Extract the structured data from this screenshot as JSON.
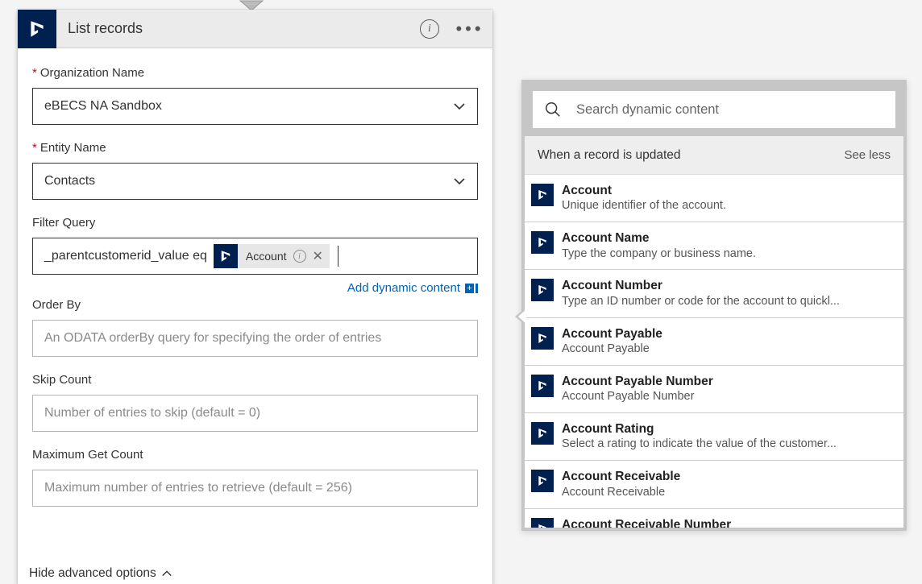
{
  "top_icon": "arrow-down",
  "card": {
    "title": "List records",
    "fields": {
      "org": {
        "label": "Organization Name",
        "value": "eBECS NA Sandbox",
        "required": true
      },
      "entity": {
        "label": "Entity Name",
        "value": "Contacts",
        "required": true
      },
      "filter": {
        "label": "Filter Query",
        "text": "_parentcustomerid_value eq",
        "token_label": "Account",
        "add_link": "Add dynamic content"
      },
      "orderby": {
        "label": "Order By",
        "placeholder": "An ODATA orderBy query for specifying the order of entries"
      },
      "skip": {
        "label": "Skip Count",
        "placeholder": "Number of entries to skip (default = 0)"
      },
      "max": {
        "label": "Maximum Get Count",
        "placeholder": "Maximum number of entries to retrieve (default = 256)"
      }
    },
    "hide_advanced": "Hide advanced options"
  },
  "panel": {
    "search_placeholder": "Search dynamic content",
    "section_title": "When a record is updated",
    "see_less": "See less",
    "items": [
      {
        "title": "Account",
        "desc": "Unique identifier of the account."
      },
      {
        "title": "Account Name",
        "desc": "Type the company or business name."
      },
      {
        "title": "Account Number",
        "desc": "Type an ID number or code for the account to quickl..."
      },
      {
        "title": "Account Payable",
        "desc": "Account Payable"
      },
      {
        "title": "Account Payable Number",
        "desc": "Account Payable Number"
      },
      {
        "title": "Account Rating",
        "desc": "Select a rating to indicate the value of the customer..."
      },
      {
        "title": "Account Receivable",
        "desc": "Account Receivable"
      },
      {
        "title": "Account Receivable Number",
        "desc": ""
      }
    ]
  }
}
